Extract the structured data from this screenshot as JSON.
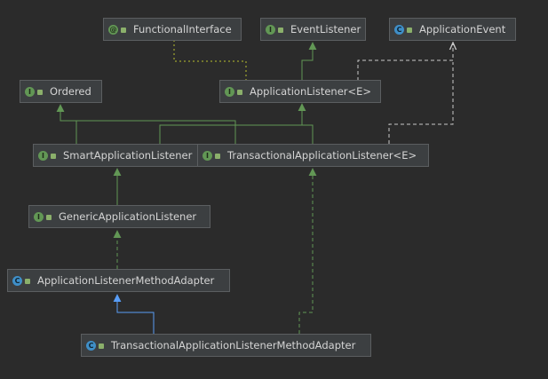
{
  "nodes": {
    "functional_interface": {
      "label": "FunctionalInterface",
      "kind": "annotation",
      "kind_glyph": "@"
    },
    "event_listener": {
      "label": "EventListener",
      "kind": "interface",
      "kind_glyph": "I"
    },
    "application_event": {
      "label": "ApplicationEvent",
      "kind": "abstract-class",
      "kind_glyph": "C"
    },
    "ordered": {
      "label": "Ordered",
      "kind": "interface",
      "kind_glyph": "I"
    },
    "application_listener": {
      "label": "ApplicationListener<E>",
      "kind": "interface",
      "kind_glyph": "I"
    },
    "smart_application_listener": {
      "label": "SmartApplicationListener",
      "kind": "interface",
      "kind_glyph": "I"
    },
    "transactional_application_listener": {
      "label": "TransactionalApplicationListener<E>",
      "kind": "interface",
      "kind_glyph": "I"
    },
    "generic_application_listener": {
      "label": "GenericApplicationListener",
      "kind": "interface",
      "kind_glyph": "I"
    },
    "application_listener_method_adapter": {
      "label": "ApplicationListenerMethodAdapter",
      "kind": "class",
      "kind_glyph": "C"
    },
    "transactional_application_listener_method_adapter": {
      "label": "TransactionalApplicationListenerMethodAdapter",
      "kind": "class",
      "kind_glyph": "C"
    }
  },
  "colors": {
    "background": "#2b2b2b",
    "node_fill": "#3c3f41",
    "node_border": "#5b5e60",
    "text": "#d4d4d4",
    "extends_interface": "#629755",
    "implements_dashed": "#629755",
    "extends_class": "#589df6",
    "dependency_dashed": "#c9c9c9",
    "annotation_dotted": "#8a8f2e"
  },
  "edge_types": [
    "extends",
    "implements",
    "class-extends",
    "type-dependency",
    "annotated-with"
  ]
}
